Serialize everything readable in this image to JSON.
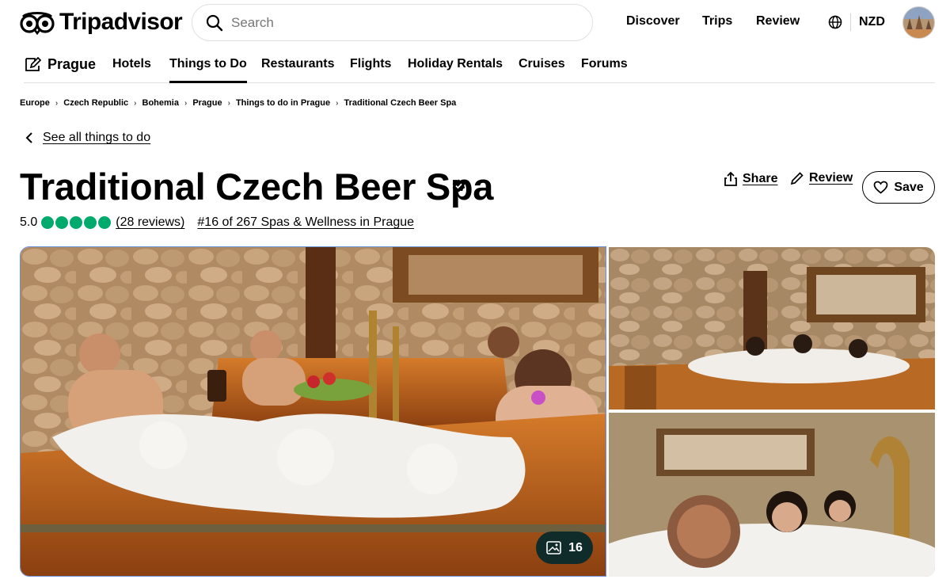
{
  "brand": {
    "name": "Tripadvisor"
  },
  "search": {
    "placeholder": "Search"
  },
  "topnav": {
    "discover": "Discover",
    "trips": "Trips",
    "review": "Review",
    "currency": "NZD"
  },
  "catnav": {
    "home": "Prague",
    "items": [
      "Hotels",
      "Things to Do",
      "Restaurants",
      "Flights",
      "Holiday Rentals",
      "Cruises",
      "Forums"
    ],
    "active": "Things to Do"
  },
  "breadcrumbs": [
    "Europe",
    "Czech Republic",
    "Bohemia",
    "Prague",
    "Things to do in Prague",
    "Traditional Czech Beer Spa"
  ],
  "back_link": "See all things to do",
  "listing": {
    "title": "Traditional Czech Beer Spa",
    "rating": "5.0",
    "rating_bubbles": 5,
    "reviews": "(28 reviews)",
    "rank": "#16 of 267 Spas & Wellness in Prague"
  },
  "actions": {
    "share": "Share",
    "review": "Review",
    "save": "Save"
  },
  "gallery": {
    "photo_count": "16"
  },
  "colors": {
    "brand_green": "#00aa6c",
    "count_badge": "#0f2b2a",
    "text": "#000000"
  },
  "icons": [
    "tripadvisor-owl-icon",
    "search-icon",
    "globe-icon",
    "pencil-home-icon",
    "chevron-right-icon",
    "chevron-left-icon",
    "verified-icon",
    "share-icon",
    "pencil-icon",
    "heart-icon",
    "image-icon"
  ]
}
